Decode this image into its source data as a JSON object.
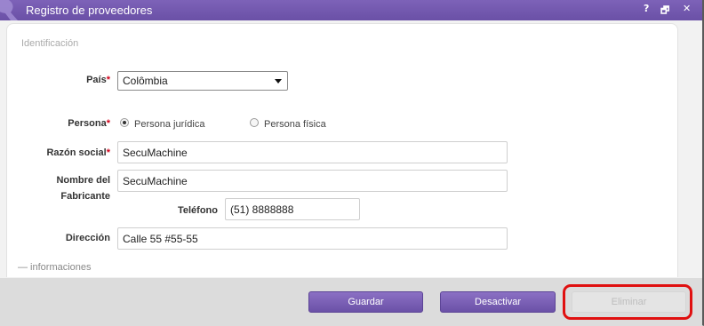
{
  "window": {
    "title": "Registro de proveedores",
    "help_label": "?",
    "restore_label": "🗗",
    "close_label": "✕"
  },
  "section": {
    "legend": "Identificación",
    "collapse_label": "— informaciones"
  },
  "form": {
    "pais": {
      "label": "País",
      "required_mark": "*",
      "value": "Colômbia"
    },
    "persona": {
      "label": "Persona",
      "required_mark": "*",
      "options": [
        "Persona jurídica",
        "Persona física"
      ],
      "selected": "Persona jurídica"
    },
    "razon_social": {
      "label": "Razón social",
      "required_mark": "*",
      "value": "SecuMachine"
    },
    "nombre_fabricante": {
      "label_line1": "Nombre del",
      "label_line2": "Fabricante",
      "value": "SecuMachine"
    },
    "telefono": {
      "label": "Teléfono",
      "value": "(51) 8888888"
    },
    "direccion": {
      "label": "Dirección",
      "value": "Calle 55 #55-55"
    }
  },
  "buttons": {
    "save": "Guardar",
    "deactivate": "Desactivar",
    "delete": "Eliminar"
  },
  "colors": {
    "titlebar": "#6a50a6",
    "button_primary": "#7a5fb6",
    "highlight": "#e01010",
    "required": "#d0021b"
  }
}
